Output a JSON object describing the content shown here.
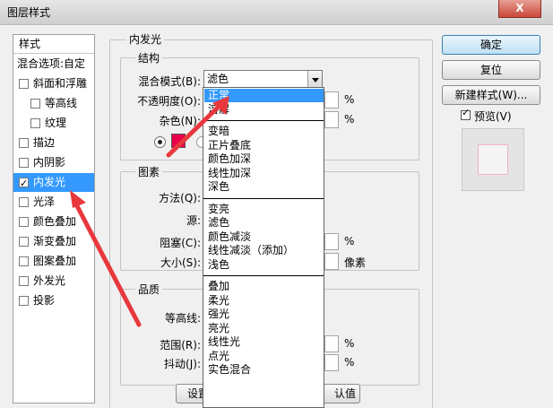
{
  "window": {
    "title": "图层样式",
    "close": "X"
  },
  "style_list": {
    "header": "样式",
    "items": [
      {
        "label": "混合选项:自定",
        "has_checkbox": false,
        "checked": false,
        "indent": 0,
        "selected": false
      },
      {
        "label": "斜面和浮雕",
        "has_checkbox": true,
        "checked": false,
        "indent": 0,
        "selected": false
      },
      {
        "label": "等高线",
        "has_checkbox": true,
        "checked": false,
        "indent": 1,
        "selected": false
      },
      {
        "label": "纹理",
        "has_checkbox": true,
        "checked": false,
        "indent": 1,
        "selected": false
      },
      {
        "label": "描边",
        "has_checkbox": true,
        "checked": false,
        "indent": 0,
        "selected": false
      },
      {
        "label": "内阴影",
        "has_checkbox": true,
        "checked": false,
        "indent": 0,
        "selected": false
      },
      {
        "label": "内发光",
        "has_checkbox": true,
        "checked": true,
        "indent": 0,
        "selected": true
      },
      {
        "label": "光泽",
        "has_checkbox": true,
        "checked": false,
        "indent": 0,
        "selected": false
      },
      {
        "label": "颜色叠加",
        "has_checkbox": true,
        "checked": false,
        "indent": 0,
        "selected": false
      },
      {
        "label": "渐变叠加",
        "has_checkbox": true,
        "checked": false,
        "indent": 0,
        "selected": false
      },
      {
        "label": "图案叠加",
        "has_checkbox": true,
        "checked": false,
        "indent": 0,
        "selected": false
      },
      {
        "label": "外发光",
        "has_checkbox": true,
        "checked": false,
        "indent": 0,
        "selected": false
      },
      {
        "label": "投影",
        "has_checkbox": true,
        "checked": false,
        "indent": 0,
        "selected": false
      }
    ]
  },
  "panel": {
    "title": "内发光",
    "structure": {
      "title": "结构",
      "blend_mode_label": "混合模式(B):",
      "blend_mode_value": "滤色",
      "opacity_label": "不透明度(O):",
      "opacity_unit": "%",
      "noise_label": "杂色(N):",
      "noise_unit": "%",
      "glow_color": "#e8004a"
    },
    "elements": {
      "title": "图素",
      "method_label": "方法(Q):",
      "source_label": "源:",
      "choke_label": "阻塞(C):",
      "choke_unit": "%",
      "size_label": "大小(S):",
      "size_unit": "像素"
    },
    "quality": {
      "title": "品质",
      "contour_label": "等高线:",
      "range_label": "范围(R):",
      "range_unit": "%",
      "jitter_label": "抖动(J):",
      "jitter_unit": "%"
    },
    "make_default": "设置",
    "reset_default": "认值"
  },
  "blend_dropdown": {
    "groups": [
      [
        "正常",
        "溶解"
      ],
      [
        "变暗",
        "正片叠底",
        "颜色加深",
        "线性加深",
        "深色"
      ],
      [
        "变亮",
        "滤色",
        "颜色减淡",
        "线性减淡（添加）",
        "浅色"
      ],
      [
        "叠加",
        "柔光",
        "强光",
        "亮光",
        "线性光",
        "点光",
        "实色混合"
      ]
    ],
    "highlighted": "正常"
  },
  "buttons": {
    "ok": "确定",
    "reset": "复位",
    "new_style": "新建样式(W)...",
    "preview_label": "预览(V)",
    "preview_checked": true
  },
  "annotation_color": "#e8383d"
}
